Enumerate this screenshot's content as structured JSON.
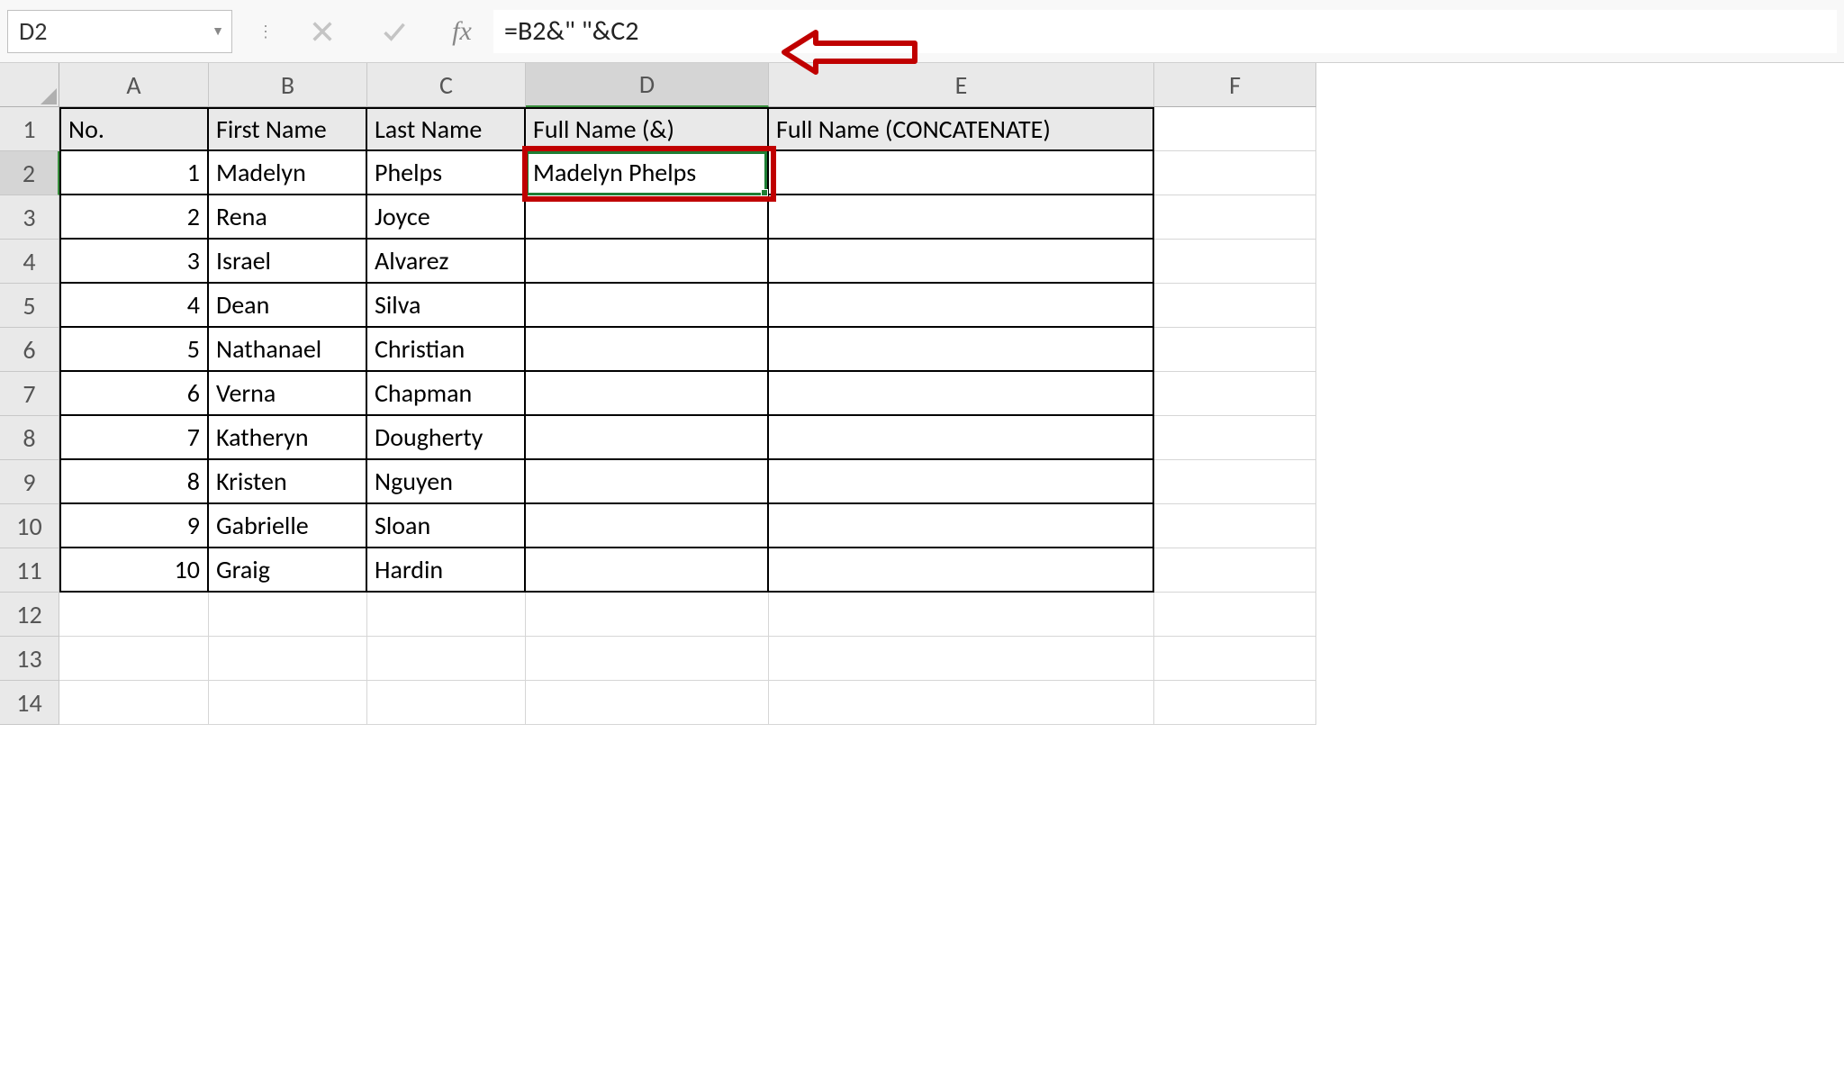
{
  "name_box": {
    "value": "D2"
  },
  "formula_bar": {
    "fx_label": "fx",
    "formula": "=B2&\" \"&C2"
  },
  "columns": [
    "A",
    "B",
    "C",
    "D",
    "E",
    "F"
  ],
  "row_numbers": [
    1,
    2,
    3,
    4,
    5,
    6,
    7,
    8,
    9,
    10,
    11,
    12,
    13,
    14
  ],
  "headers": {
    "A": "No.",
    "B": "First Name",
    "C": "Last Name",
    "D": "Full Name (&)",
    "E": "Full Name (CONCATENATE)"
  },
  "rows": [
    {
      "no": "1",
      "first": "Madelyn",
      "last": "Phelps",
      "full": "Madelyn Phelps",
      "concat": ""
    },
    {
      "no": "2",
      "first": "Rena",
      "last": "Joyce",
      "full": "",
      "concat": ""
    },
    {
      "no": "3",
      "first": "Israel",
      "last": "Alvarez",
      "full": "",
      "concat": ""
    },
    {
      "no": "4",
      "first": "Dean",
      "last": "Silva",
      "full": "",
      "concat": ""
    },
    {
      "no": "5",
      "first": "Nathanael",
      "last": "Christian",
      "full": "",
      "concat": ""
    },
    {
      "no": "6",
      "first": "Verna",
      "last": "Chapman",
      "full": "",
      "concat": ""
    },
    {
      "no": "7",
      "first": "Katheryn",
      "last": "Dougherty",
      "full": "",
      "concat": ""
    },
    {
      "no": "8",
      "first": "Kristen",
      "last": "Nguyen",
      "full": "",
      "concat": ""
    },
    {
      "no": "9",
      "first": "Gabrielle",
      "last": "Sloan",
      "full": "",
      "concat": ""
    },
    {
      "no": "10",
      "first": "Graig",
      "last": "Hardin",
      "full": "",
      "concat": ""
    }
  ],
  "selected_cell": "D2",
  "selected_row": 2,
  "selected_col": "D",
  "annotation": {
    "arrow_color": "#c00000",
    "highlight_color": "#c00000"
  }
}
